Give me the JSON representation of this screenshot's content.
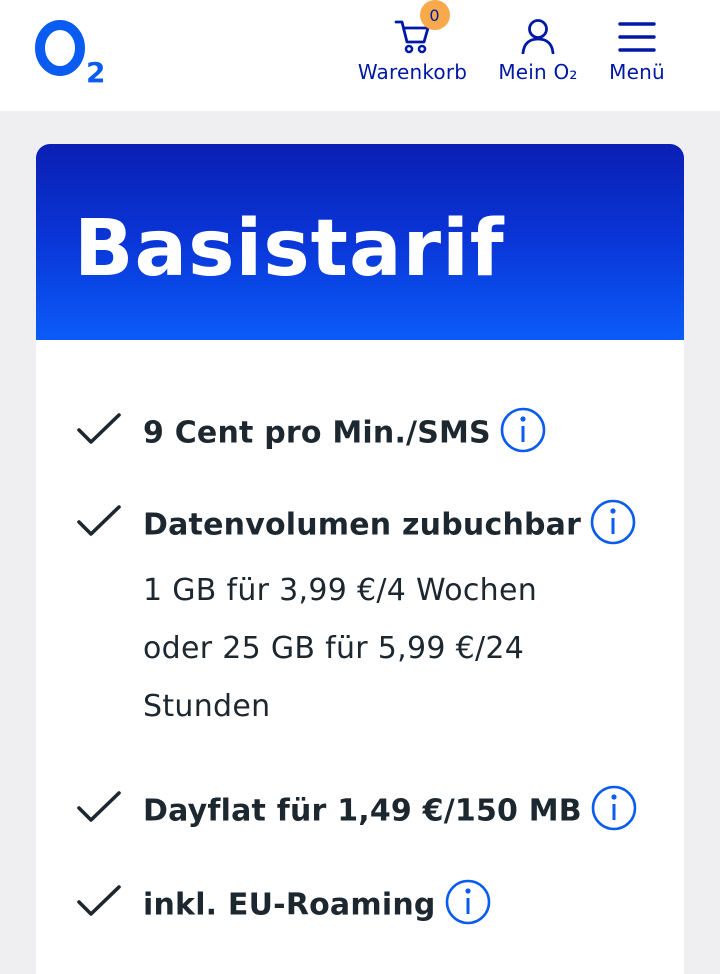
{
  "header": {
    "logo_alt": "O2",
    "cart": {
      "label": "Warenkorb",
      "badge": "0"
    },
    "account": {
      "label": "Mein O₂"
    },
    "menu": {
      "label": "Menü"
    }
  },
  "card": {
    "title": "Basistarif",
    "features": [
      {
        "title": "9 Cent pro Min./SMS",
        "desc": ""
      },
      {
        "title": "Datenvolumen zubuchbar",
        "desc": "1 GB für 3,99 €/4 Wochen oder 25 GB für 5,99 €/24 Stunden"
      },
      {
        "title": "Dayflat für 1,49 €/150 MB",
        "desc": ""
      },
      {
        "title": "inkl. EU-Roaming",
        "desc": ""
      }
    ]
  },
  "colors": {
    "brand_blue": "#0019a5",
    "header_gradient_top": "#0a1fb3",
    "header_gradient_bottom": "#0b5cf9",
    "badge": "#f7a94c",
    "info_icon": "#0a5cf0"
  },
  "icons": [
    "o2-logo",
    "cart-icon",
    "user-icon",
    "hamburger-icon",
    "check-icon",
    "info-icon"
  ]
}
